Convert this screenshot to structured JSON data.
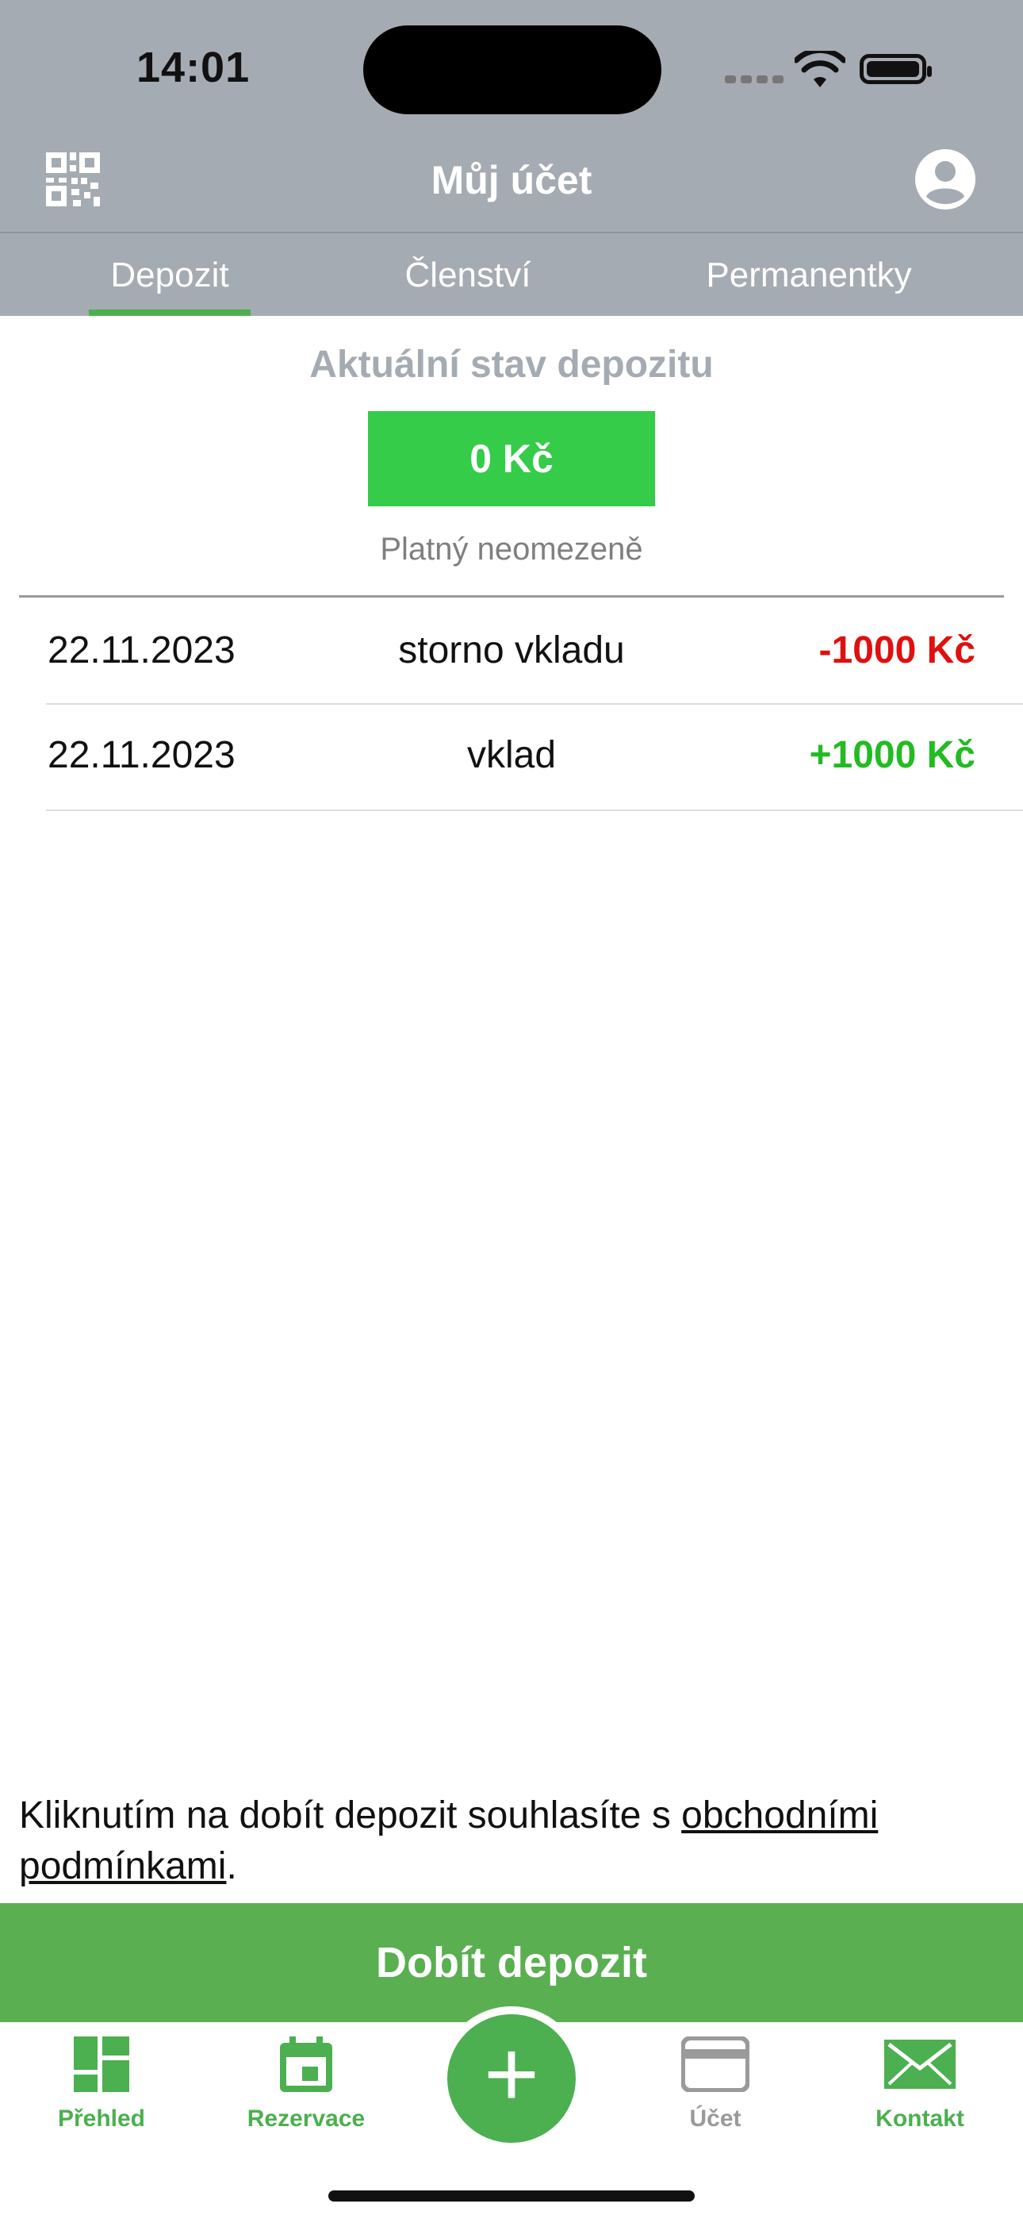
{
  "status_bar": {
    "time": "14:01"
  },
  "header": {
    "title": "Můj účet"
  },
  "tabs": [
    {
      "label": "Depozit",
      "active": true
    },
    {
      "label": "Členství"
    },
    {
      "label": "Permanentky"
    }
  ],
  "deposit": {
    "title": "Aktuální stav depozitu",
    "balance": "0 Kč",
    "validity": "Platný neomezeně"
  },
  "transactions": [
    {
      "date": "22.11.2023",
      "description": "storno vkladu",
      "amount": "-1000 Kč"
    },
    {
      "date": "22.11.2023",
      "description": "vklad",
      "amount": "+1000 Kč"
    }
  ],
  "terms": {
    "text": "Kliknutím na dobít depozit souhlasíte s ",
    "link": "obchodními podmínkami",
    "end": "."
  },
  "cta_label": "Dobít depozit",
  "bottom_nav": [
    {
      "label": "Přehled",
      "icon": "dashboard-icon"
    },
    {
      "label": "Rezervace",
      "icon": "calendar-icon"
    },
    {
      "label": "Účet",
      "icon": "card-icon"
    },
    {
      "label": "Kontakt",
      "icon": "mail-icon"
    }
  ],
  "fab_label": "+",
  "colors": {
    "header_bg": "#a5abb2",
    "accent_green": "#4caf50",
    "balance_green": "#34cc48",
    "negative": "#e01010",
    "positive": "#22bb22",
    "inactive_gray": "#9a9a9a"
  }
}
